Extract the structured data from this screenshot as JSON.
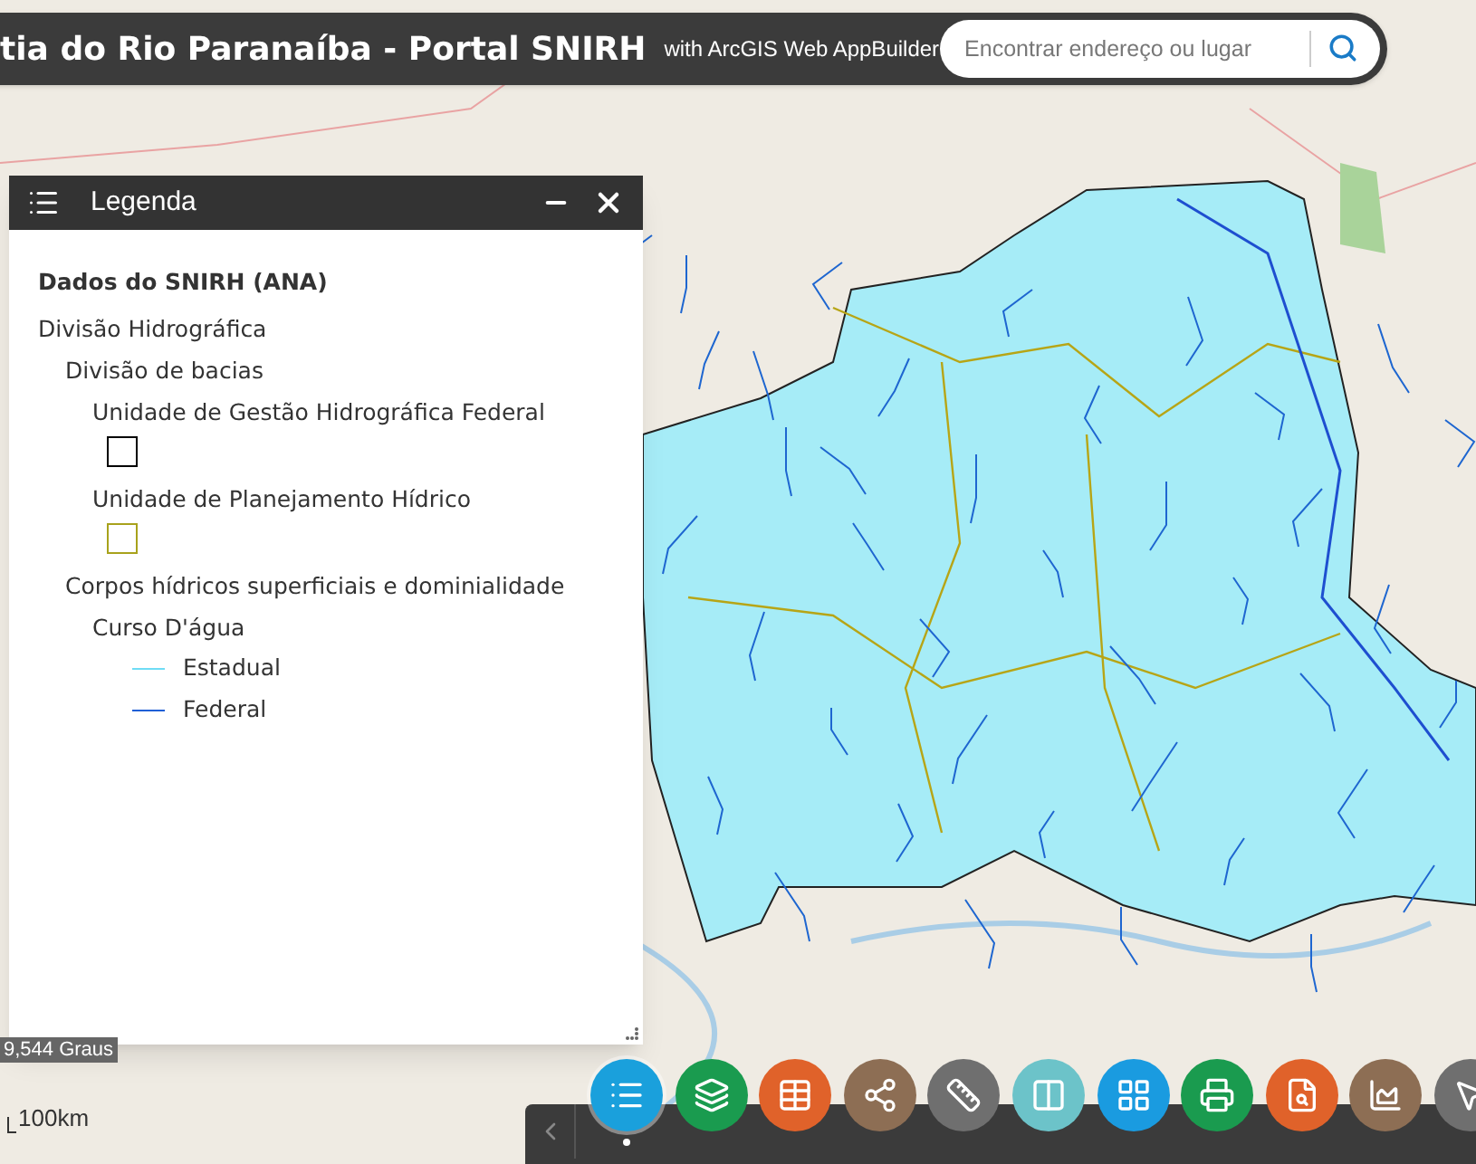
{
  "header": {
    "title": "tia do Rio Paranaíba - Portal SNIRH",
    "subtitle": "with ArcGIS Web AppBuilder",
    "search": {
      "placeholder": "Encontrar endereço ou lugar"
    }
  },
  "legend": {
    "title": "Legenda",
    "layer": "Dados do SNIRH (ANA)",
    "items": [
      {
        "label": "Divisão Hidrográfica",
        "children": [
          {
            "label": "Divisão de bacias",
            "children": [
              {
                "label": "Unidade de Gestão Hidrográfica Federal",
                "kind": "box",
                "color": "#000000"
              },
              {
                "label": "Unidade de Planejamento Hídrico",
                "kind": "box",
                "color": "#a8a21c"
              }
            ]
          },
          {
            "label": "Corpos hídricos superficiais e dominialidade",
            "children": [
              {
                "label": "Curso D'água",
                "children": [
                  {
                    "label": "Estadual",
                    "kind": "line",
                    "color": "#6fdcf5"
                  },
                  {
                    "label": "Federal",
                    "kind": "line",
                    "color": "#1f5fd6"
                  }
                ]
              }
            ]
          }
        ]
      }
    ]
  },
  "coordinates": "9,544 Graus",
  "scale": "100km",
  "widgets": [
    {
      "color": "#1aa0dc",
      "selected": true
    },
    {
      "color": "#1a9b4f",
      "selected": false
    },
    {
      "color": "#e0622a",
      "selected": false
    },
    {
      "color": "#8d6e54",
      "selected": false
    },
    {
      "color": "#6f6f6f",
      "selected": false
    },
    {
      "color": "#6cc3c9",
      "selected": false
    },
    {
      "color": "#1a9be0",
      "selected": false
    },
    {
      "color": "#1a9b4f",
      "selected": false
    },
    {
      "color": "#e0622a",
      "selected": false
    },
    {
      "color": "#8d6e54",
      "selected": false
    },
    {
      "color": "#6f6f6f",
      "selected": false
    }
  ]
}
